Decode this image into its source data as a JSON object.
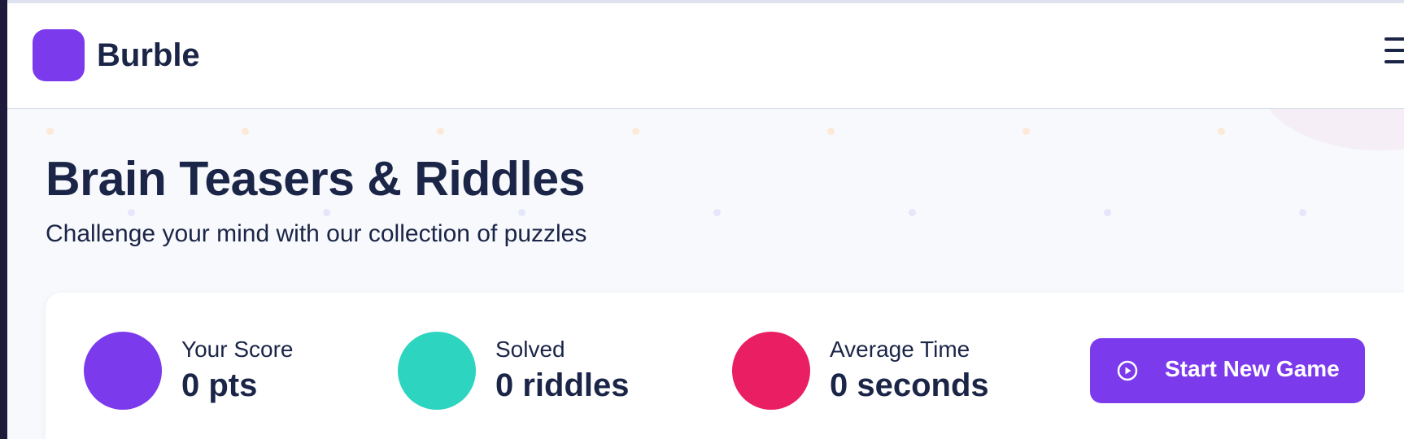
{
  "app": {
    "name": "Burble"
  },
  "page": {
    "title": "Brain Teasers & Riddles",
    "subtitle": "Challenge your mind with our collection of puzzles"
  },
  "stats": [
    {
      "label": "Your Score",
      "value": "0 pts",
      "color": "#7c3aed",
      "icon": "score-badge"
    },
    {
      "label": "Solved",
      "value": "0 riddles",
      "color": "#2dd4bf",
      "icon": "solved-badge"
    },
    {
      "label": "Average Time",
      "value": "0 seconds",
      "color": "#e91e63",
      "icon": "timer-badge"
    }
  ],
  "actions": {
    "start_label": "Start New Game",
    "start_icon": "play-circle-icon"
  },
  "colors": {
    "accent": "#7c3aed",
    "text": "#1b2547",
    "background": "#f7f9fc"
  }
}
